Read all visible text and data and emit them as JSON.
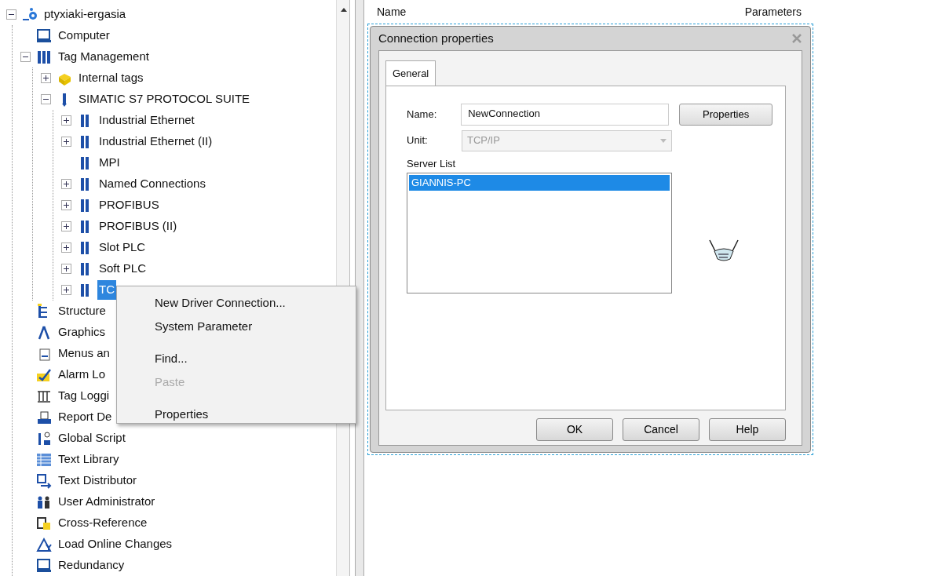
{
  "tree": [
    {
      "label": "ptyxiaki-ergasia",
      "expanded": true,
      "selected": false,
      "children": [
        {
          "label": "Computer",
          "selected": false
        },
        {
          "label": "Tag Management",
          "expanded": true,
          "selected": false,
          "children": [
            {
              "label": "Internal tags",
              "expanded": false,
              "selected": false
            },
            {
              "label": "SIMATIC S7 PROTOCOL SUITE",
              "expanded": true,
              "selected": false,
              "children": [
                {
                  "label": "Industrial Ethernet",
                  "expanded": false,
                  "selected": false
                },
                {
                  "label": "Industrial Ethernet (II)",
                  "expanded": false,
                  "selected": false
                },
                {
                  "label": "MPI",
                  "selected": false
                },
                {
                  "label": "Named Connections",
                  "expanded": false,
                  "selected": false
                },
                {
                  "label": "PROFIBUS",
                  "expanded": false,
                  "selected": false
                },
                {
                  "label": "PROFIBUS (II)",
                  "expanded": false,
                  "selected": false
                },
                {
                  "label": "Slot PLC",
                  "expanded": false,
                  "selected": false
                },
                {
                  "label": "Soft PLC",
                  "expanded": false,
                  "selected": false
                },
                {
                  "label": "TC",
                  "expanded": false,
                  "selected": true
                }
              ]
            }
          ]
        },
        {
          "label": "Structure",
          "selected": false
        },
        {
          "label": "Graphics",
          "selected": false
        },
        {
          "label": "Menus an",
          "selected": false
        },
        {
          "label": "Alarm Lo",
          "selected": false
        },
        {
          "label": "Tag Loggi",
          "selected": false
        },
        {
          "label": "Report De",
          "selected": false
        },
        {
          "label": "Global Script",
          "selected": false
        },
        {
          "label": "Text Library",
          "selected": false
        },
        {
          "label": "Text Distributor",
          "selected": false
        },
        {
          "label": "User Administrator",
          "selected": false
        },
        {
          "label": "Cross-Reference",
          "selected": false
        },
        {
          "label": "Load Online Changes",
          "selected": false
        },
        {
          "label": "Redundancy",
          "selected": false
        }
      ]
    }
  ],
  "context_menu": [
    {
      "kind": "item",
      "label": "New Driver Connection...",
      "disabled": false
    },
    {
      "kind": "item",
      "label": "System Parameter",
      "disabled": false
    },
    {
      "kind": "separator"
    },
    {
      "kind": "item",
      "label": "Find...",
      "disabled": false
    },
    {
      "kind": "item",
      "label": "Paste",
      "disabled": true
    },
    {
      "kind": "separator"
    },
    {
      "kind": "item",
      "label": "Properties",
      "disabled": false
    }
  ],
  "list_header": {
    "column_1": "Name",
    "column_2": "Parameters"
  },
  "dialog": {
    "title": "Connection properties",
    "tabs": [
      {
        "label": "General",
        "selected": true
      }
    ],
    "name": {
      "label": "Name:",
      "value": "NewConnection"
    },
    "unit": {
      "label": "Unit:",
      "value": "TCP/IP",
      "disabled": true
    },
    "properties_button": "Properties",
    "server_list": {
      "label": "Server List",
      "items": [
        {
          "label": "GIANNIS-PC",
          "selected": true
        }
      ]
    },
    "buttons": [
      "OK",
      "Cancel",
      "Help"
    ]
  }
}
